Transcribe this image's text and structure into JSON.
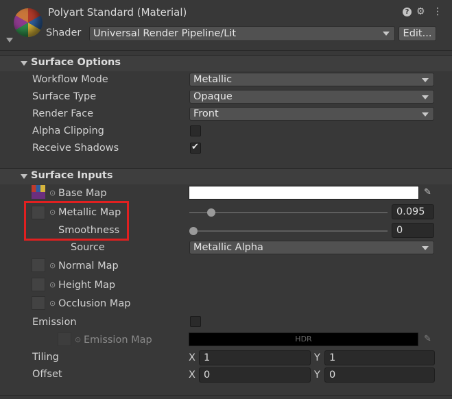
{
  "header": {
    "title": "Polyart Standard (Material)",
    "shader_label": "Shader",
    "shader_value": "Universal Render Pipeline/Lit",
    "edit_button": "Edit..."
  },
  "surface_options": {
    "title": "Surface Options",
    "rows": [
      {
        "label": "Workflow Mode",
        "value": "Metallic"
      },
      {
        "label": "Surface Type",
        "value": "Opaque"
      },
      {
        "label": "Render Face",
        "value": "Front"
      },
      {
        "label": "Alpha Clipping",
        "checked": false
      },
      {
        "label": "Receive Shadows",
        "checked": true
      }
    ]
  },
  "surface_inputs": {
    "title": "Surface Inputs",
    "base_map": "Base Map",
    "metallic_map": "Metallic Map",
    "metallic_value": "0.095",
    "metallic_level": 0.095,
    "smoothness": "Smoothness",
    "smoothness_value": "0",
    "smoothness_level": 0,
    "source_label": "Source",
    "source_value": "Metallic Alpha",
    "normal_map": "Normal Map",
    "height_map": "Height Map",
    "occlusion_map": "Occlusion Map",
    "emission": "Emission",
    "emission_map": "Emission Map",
    "hdr": "HDR",
    "tiling": "Tiling",
    "offset": "Offset",
    "x_label": "X",
    "y_label": "Y",
    "tiling_x": "1",
    "tiling_y": "1",
    "offset_x": "0",
    "offset_y": "0"
  },
  "colors": {
    "highlight": "#e02020",
    "base_color": "#ffffff",
    "emission_color": "#000000"
  }
}
